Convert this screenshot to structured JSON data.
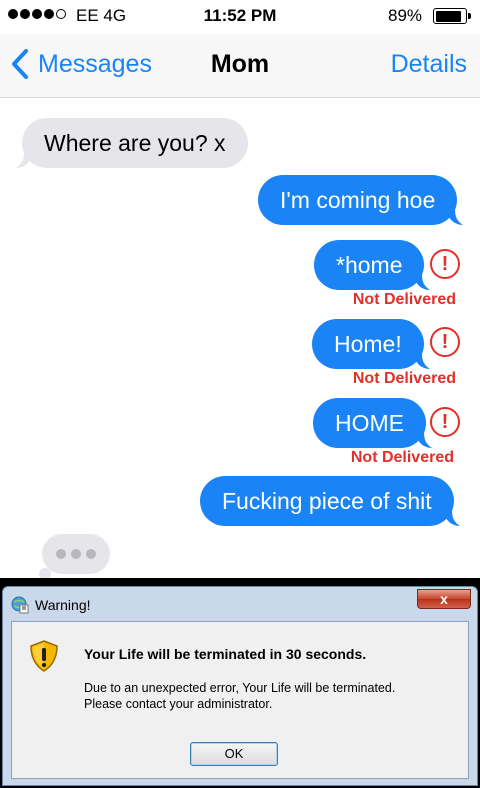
{
  "status_bar": {
    "signal_bars_filled": 4,
    "signal_bars_total": 5,
    "carrier": "EE  4G",
    "time": "11:52 PM",
    "battery_percent": "89%",
    "battery_level": 0.89
  },
  "nav": {
    "back_label": "Messages",
    "title": "Mom",
    "details_label": "Details",
    "accent_color": "#1a83f5"
  },
  "messages": [
    {
      "direction": "incoming",
      "text": "Where are you? x"
    },
    {
      "direction": "outgoing",
      "text": "I'm coming hoe"
    },
    {
      "direction": "outgoing",
      "text": "*home",
      "status": "Not Delivered",
      "error_icon": "!"
    },
    {
      "direction": "outgoing",
      "text": "Home!",
      "status": "Not Delivered",
      "error_icon": "!"
    },
    {
      "direction": "outgoing",
      "text": "HOME",
      "status": "Not Delivered",
      "error_icon": "!"
    },
    {
      "direction": "outgoing",
      "text": "Fucking piece of shit"
    }
  ],
  "typing_indicator": {
    "icon": "typing-dots-icon"
  },
  "colors": {
    "incoming_bubble": "#e5e5ea",
    "outgoing_bubble": "#1a83f5",
    "error": "#e1302a"
  },
  "dialog": {
    "title": "Warning!",
    "close_label": "x",
    "heading": "Your Life will be terminated in 30 seconds.",
    "line1": "Due to an unexpected error, Your Life will be terminated.",
    "line2": "Please contact your administrator.",
    "ok_label": "OK",
    "icon": "warning-shield-icon"
  }
}
